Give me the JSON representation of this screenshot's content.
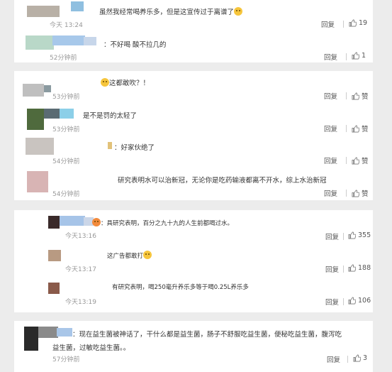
{
  "reply_label": "回复",
  "comments": [
    {
      "text": "虽然我经常喝养乐多，但是这宣传过于离谱了",
      "time": "今天 13:24",
      "likes": "19",
      "emoji": "grinning-emoji"
    },
    {
      "text": "：不好喝  酸不拉几的",
      "time": "52分钟前",
      "likes": "1"
    },
    {
      "text": "这都敢吹？！",
      "time": "53分钟前",
      "likes": "赞",
      "emoji": "sweat-smile-emoji"
    },
    {
      "text": "是不是罚的太轻了",
      "time": "53分钟前",
      "likes": "赞"
    },
    {
      "text": "：好家伙绝了",
      "time": "54分钟前",
      "likes": "赞"
    },
    {
      "text": "研究表明水可以治新冠，无论你是吃药输液都离不开水，综上水治新冠",
      "time": "54分钟前",
      "likes": "赞"
    },
    {
      "text": "：具研究表明，百分之九十九的人生前都喝过水。",
      "time": "今天13:16",
      "likes": "355",
      "emoji": "red-emoji"
    },
    {
      "text": "这广告都敢打",
      "time": "今天13:17",
      "likes": "188",
      "emoji": "cat-emoji"
    },
    {
      "text": "有研究表明，喝250毫升养乐多等于喝0.25L养乐多",
      "time": "今天13:19",
      "likes": "106"
    },
    {
      "text_line1": "：现在益生菌被神话了，干什么都是益生菌，肠子不舒服吃益生菌，便秘吃益生菌，腹泻吃",
      "text_line2": "益生菌，过敏吃益生菌。。",
      "time": "57分钟前",
      "likes": "3"
    }
  ]
}
